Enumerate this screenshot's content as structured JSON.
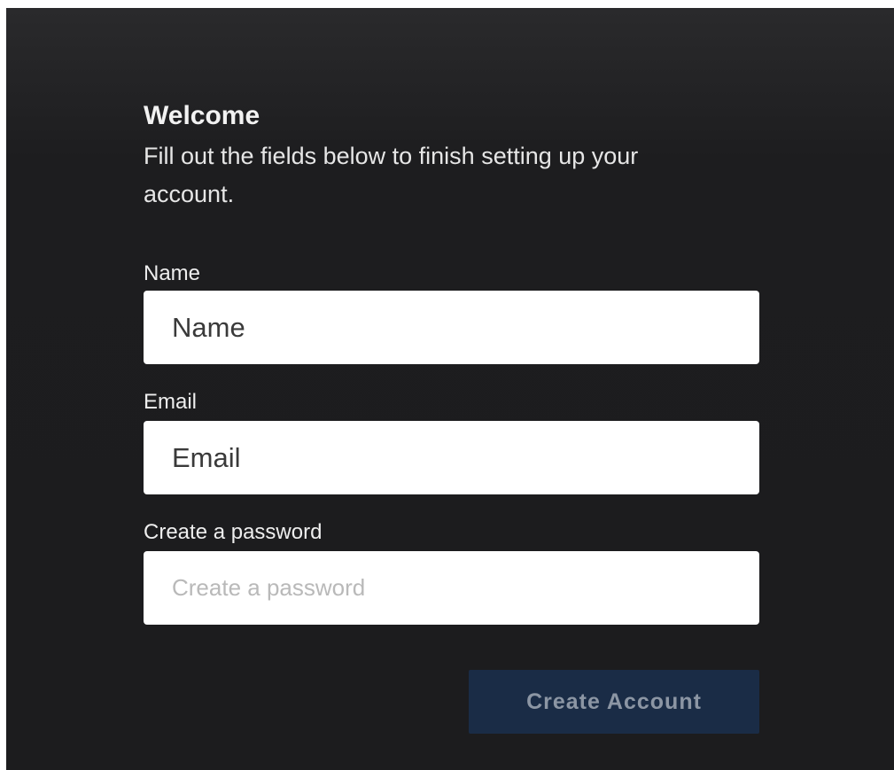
{
  "form": {
    "title": "Welcome",
    "subtitle": "Fill out the fields below to finish setting up your account.",
    "fields": [
      {
        "label": "Name",
        "placeholder": "Name",
        "value": ""
      },
      {
        "label": "Email",
        "placeholder": "Email",
        "value": ""
      },
      {
        "label": "Create a password",
        "placeholder": "Create a password",
        "value": ""
      }
    ],
    "submit_label": "Create Account"
  },
  "colors": {
    "background": "#1c1c1e",
    "button_bg": "#1a2c46",
    "button_text": "#8c96a4",
    "input_bg": "#ffffff"
  }
}
